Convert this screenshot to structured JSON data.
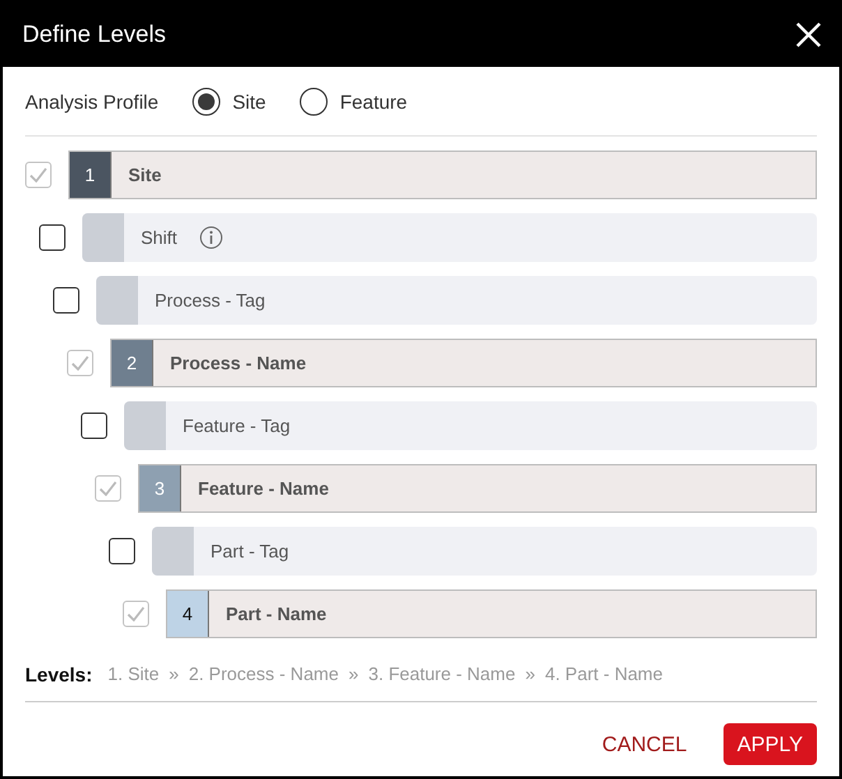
{
  "window": {
    "title": "Define Levels"
  },
  "profile": {
    "label": "Analysis Profile",
    "options": [
      {
        "label": "Site",
        "selected": true
      },
      {
        "label": "Feature",
        "selected": false
      }
    ]
  },
  "levels_tree": [
    {
      "label": "Site",
      "checked": true,
      "number": "1",
      "color": "#4b5561",
      "children": [
        {
          "label": "Shift",
          "checked": false,
          "info": true,
          "children": [
            {
              "label": "Process - Tag",
              "checked": false,
              "children": [
                {
                  "label": "Process - Name",
                  "checked": true,
                  "number": "2",
                  "color": "#6f7f8f",
                  "children": [
                    {
                      "label": "Feature - Tag",
                      "checked": false,
                      "children": [
                        {
                          "label": "Feature - Name",
                          "checked": true,
                          "number": "3",
                          "color": "#8ea0b1",
                          "children": [
                            {
                              "label": "Part - Tag",
                              "checked": false,
                              "children": [
                                {
                                  "label": "Part - Name",
                                  "checked": true,
                                  "number": "4",
                                  "color": "#bed3e6"
                                }
                              ]
                            }
                          ]
                        }
                      ]
                    }
                  ]
                }
              ]
            }
          ]
        }
      ]
    }
  ],
  "summary": {
    "label": "Levels:",
    "separator": "»",
    "items": [
      "1. Site",
      "2. Process - Name",
      "3. Feature - Name",
      "4. Part - Name"
    ]
  },
  "buttons": {
    "cancel": "CANCEL",
    "apply": "APPLY"
  }
}
